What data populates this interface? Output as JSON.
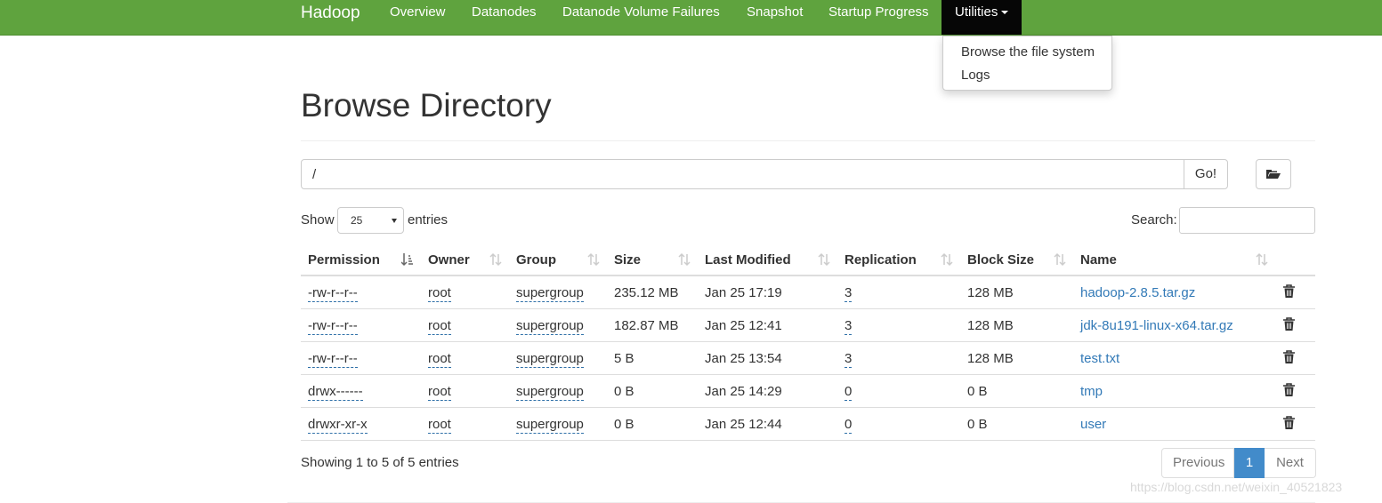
{
  "navbar": {
    "brand": "Hadoop",
    "items": [
      "Overview",
      "Datanodes",
      "Datanode Volume Failures",
      "Snapshot",
      "Startup Progress"
    ],
    "active_item": "Utilities",
    "dropdown": [
      "Browse the file system",
      "Logs"
    ]
  },
  "page": {
    "title": "Browse Directory",
    "path_value": "/",
    "go_label": "Go!",
    "show_label": "Show",
    "entries_value": "25",
    "entries_label": "entries",
    "search_label": "Search:"
  },
  "table": {
    "columns": [
      "Permission",
      "Owner",
      "Group",
      "Size",
      "Last Modified",
      "Replication",
      "Block Size",
      "Name"
    ],
    "rows": [
      [
        "-rw-r--r--",
        "root",
        "supergroup",
        "235.12 MB",
        "Jan 25 17:19",
        "3",
        "128 MB",
        "hadoop-2.8.5.tar.gz"
      ],
      [
        "-rw-r--r--",
        "root",
        "supergroup",
        "182.87 MB",
        "Jan 25 12:41",
        "3",
        "128 MB",
        "jdk-8u191-linux-x64.tar.gz"
      ],
      [
        "-rw-r--r--",
        "root",
        "supergroup",
        "5 B",
        "Jan 25 13:54",
        "3",
        "128 MB",
        "test.txt"
      ],
      [
        "drwx------",
        "root",
        "supergroup",
        "0 B",
        "Jan 25 14:29",
        "0",
        "0 B",
        "tmp"
      ],
      [
        "drwxr-xr-x",
        "root",
        "supergroup",
        "0 B",
        "Jan 25 12:44",
        "0",
        "0 B",
        "user"
      ]
    ]
  },
  "footer": {
    "showing": "Showing 1 to 5 of 5 entries",
    "prev": "Previous",
    "current_page": "1",
    "next": "Next"
  },
  "watermark": "https://blog.csdn.net/weixin_40521823",
  "colors": {
    "navbar": "#5fa33e",
    "active_nav": "#060606",
    "link": "#337ab7",
    "pager_active": "#428bca"
  }
}
